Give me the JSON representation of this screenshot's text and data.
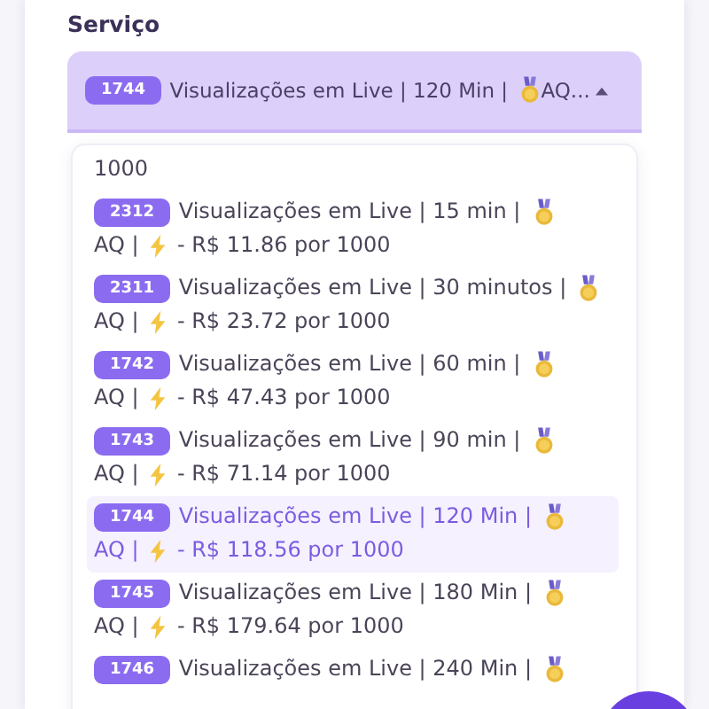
{
  "field_label": "Serviço",
  "select": {
    "id": "1744",
    "title": "Visualizações em Live | 120 Min |",
    "tail": "AQ...",
    "expanded": true
  },
  "list_top_fragment": "1000",
  "options": [
    {
      "id": "2312",
      "title": "Visualizações em Live | 15 min |",
      "tag": "AQ |",
      "price": "- R$ 11.86 por 1000",
      "selected": false
    },
    {
      "id": "2311",
      "title": "Visualizações em Live | 30 minutos |",
      "tag": "AQ |",
      "price": "- R$ 23.72 por 1000",
      "selected": false
    },
    {
      "id": "1742",
      "title": "Visualizações em Live | 60 min |",
      "tag": "AQ |",
      "price": "- R$ 47.43 por 1000",
      "selected": false
    },
    {
      "id": "1743",
      "title": "Visualizações em Live | 90 min |",
      "tag": "AQ |",
      "price": "- R$ 71.14 por 1000",
      "selected": false
    },
    {
      "id": "1744",
      "title": "Visualizações em Live | 120 Min |",
      "tag": "AQ |",
      "price": "- R$ 118.56 por 1000",
      "selected": true
    },
    {
      "id": "1745",
      "title": "Visualizações em Live | 180 Min |",
      "tag": "AQ |",
      "price": "- R$ 179.64 por 1000",
      "selected": false
    },
    {
      "id": "1746",
      "title": "Visualizações em Live | 240 Min |",
      "selected": false
    }
  ]
}
